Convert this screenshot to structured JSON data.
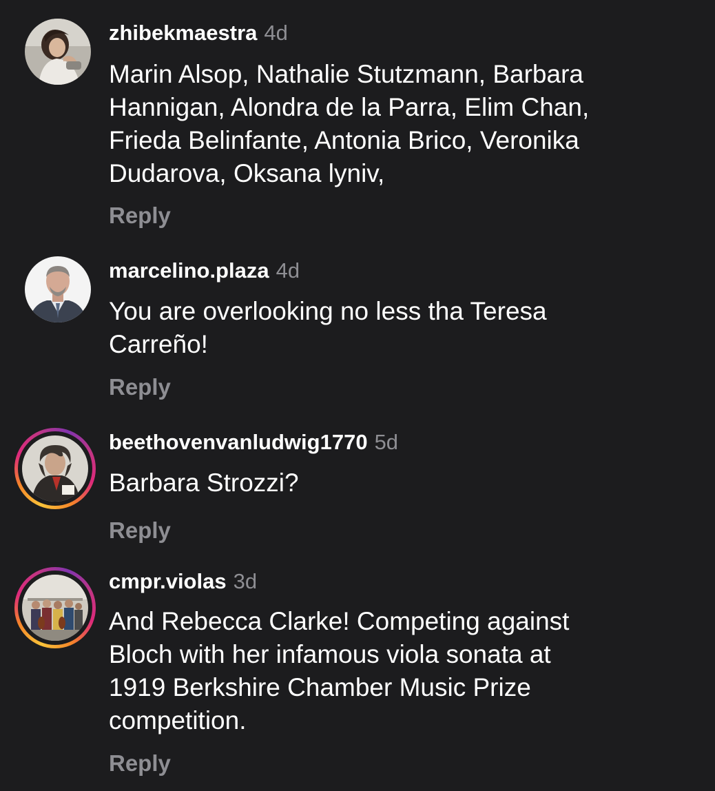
{
  "comments": [
    {
      "username": "zhibekmaestra",
      "time": "4d",
      "lines": [
        "Marin Alsop, Nathalie Stutzmann, Barbara",
        "Hannigan, Alondra de la Parra, Elim Chan,",
        "Frieda Belinfante, Antonia Brico, Veronika",
        "Dudarova, Oksana lyniv,"
      ],
      "reply_label": "Reply",
      "avatar": "woman-portrait-avatar",
      "has_story_ring": false
    },
    {
      "username": "marcelino.plaza",
      "time": "4d",
      "lines": [
        "You are overlooking no less tha Teresa",
        "Carreño!"
      ],
      "reply_label": "Reply",
      "avatar": "man-in-suit-avatar",
      "has_story_ring": false
    },
    {
      "username": "beethovenvanludwig1770",
      "time": "5d",
      "lines": [
        "Barbara Strozzi?"
      ],
      "reply_label": "Reply",
      "avatar": "beethoven-portrait-avatar",
      "has_story_ring": true
    },
    {
      "username": "cmpr.violas",
      "time": "3d",
      "lines": [
        "And Rebecca Clarke! Competing against",
        "Bloch with her infamous viola sonata at",
        "1919 Berkshire Chamber Music Prize",
        "competition."
      ],
      "reply_label": "Reply",
      "avatar": "group-of-violists-avatar",
      "has_story_ring": true
    }
  ],
  "colors": {
    "background": "#1c1c1e",
    "text": "#ffffff",
    "muted": "#8e8e93",
    "ring_start": "#f9c33a",
    "ring_end": "#c13584"
  }
}
